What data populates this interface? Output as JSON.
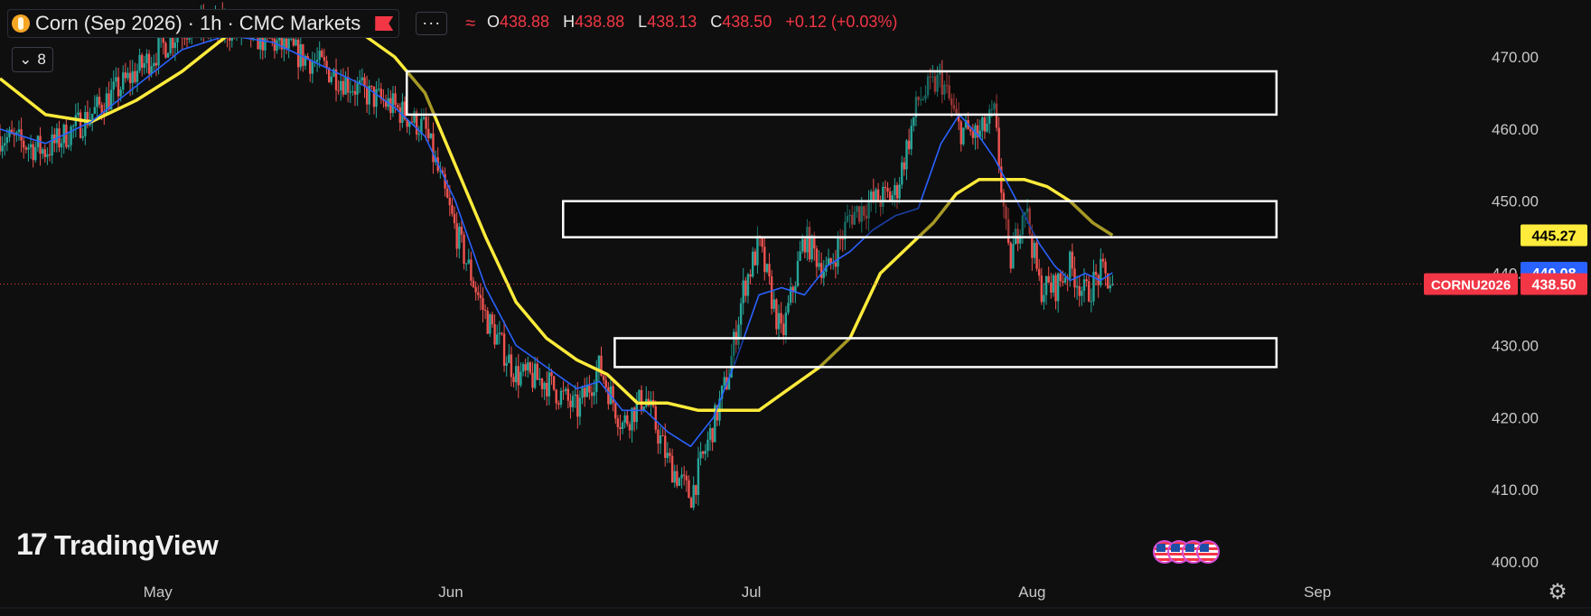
{
  "header": {
    "symbol_title": "Corn (Sep 2026)",
    "sep1": "·",
    "interval": "1h",
    "sep2": "·",
    "source": "CMC Markets",
    "more_label": "···",
    "wave_glyph": "≈",
    "ohlc": {
      "o_label": "O",
      "o_value": "438.88",
      "h_label": "H",
      "h_value": "438.88",
      "l_label": "L",
      "l_value": "438.13",
      "c_label": "C",
      "c_value": "438.50",
      "change": "+0.12 (+0.03%)"
    },
    "indicator_count": "8",
    "collapse_icon": "chevron-down-icon"
  },
  "branding": {
    "logo_mark": "17",
    "logo_text": "TradingView"
  },
  "icons": {
    "symbol": "corn-coin-icon",
    "events": "us-flag-icon",
    "settings": "gear-icon"
  },
  "colors": {
    "background": "#0f0f0f",
    "candle_up": "#26a69a",
    "candle_down": "#ef5350",
    "ma_long": "#ffeb3b",
    "ma_short": "#2962ff",
    "box_stroke": "#ffffff",
    "label_red": "#f23645",
    "label_blue": "#2962ff",
    "label_yellow": "#ffeb3b"
  },
  "price_labels": [
    {
      "value": "445.27",
      "color": "#ffeb3b",
      "text_color": "#000000"
    },
    {
      "value": "440.08",
      "color": "#2962ff",
      "text_color": "#ffffff"
    },
    {
      "value": "438.50",
      "color": "#f23645",
      "text_color": "#ffffff",
      "tag": "CORNU2026"
    }
  ],
  "chart_data": {
    "type": "line",
    "grid": false,
    "y_axis": {
      "side": "right",
      "ylim": [
        400,
        470
      ],
      "ticks": [
        "470.00",
        "460.00",
        "450.00",
        "440.00",
        "430.00",
        "420.00",
        "410.00",
        "400.00"
      ]
    },
    "x_axis": {
      "ticks": [
        "May",
        "Jun",
        "Jul",
        "Aug",
        "Sep"
      ]
    },
    "x_ticks_index": [
      0.104,
      0.297,
      0.495,
      0.68,
      0.868
    ],
    "last_price": 438.5,
    "series": [
      {
        "role": "price",
        "x": [
          0.0,
          0.03,
          0.06,
          0.09,
          0.12,
          0.15,
          0.18,
          0.21,
          0.24,
          0.26,
          0.28,
          0.3,
          0.32,
          0.34,
          0.36,
          0.38,
          0.395,
          0.41,
          0.425,
          0.44,
          0.455,
          0.47,
          0.48,
          0.49,
          0.5,
          0.515,
          0.53,
          0.545,
          0.56,
          0.575,
          0.59,
          0.605,
          0.62,
          0.632,
          0.645,
          0.655,
          0.665,
          0.675,
          0.685,
          0.695,
          0.705,
          0.715,
          0.725,
          0.733
        ],
        "y": [
          459,
          457,
          462,
          468,
          474,
          474,
          472,
          469,
          465,
          463,
          460,
          446,
          434,
          426,
          425,
          421,
          427,
          419,
          423,
          414,
          409,
          419,
          426,
          438,
          444,
          431,
          445,
          440,
          448,
          450,
          451,
          464,
          467,
          460,
          459,
          462,
          441,
          450,
          438,
          438,
          441,
          437,
          440,
          438.5
        ]
      },
      {
        "role": "moving-average-long",
        "x": [
          0.0,
          0.03,
          0.06,
          0.09,
          0.12,
          0.15,
          0.18,
          0.21,
          0.24,
          0.26,
          0.28,
          0.3,
          0.32,
          0.34,
          0.36,
          0.38,
          0.4,
          0.42,
          0.44,
          0.46,
          0.48,
          0.5,
          0.52,
          0.54,
          0.56,
          0.58,
          0.6,
          0.615,
          0.63,
          0.645,
          0.66,
          0.675,
          0.69,
          0.705,
          0.72,
          0.733
        ],
        "y": [
          467,
          462,
          461,
          464,
          468,
          473,
          475,
          474,
          473,
          470,
          465,
          455,
          445,
          436,
          431,
          428,
          426,
          422,
          422,
          421,
          421,
          421,
          424,
          427,
          431,
          440,
          444,
          447,
          451,
          453,
          453,
          453,
          452,
          450,
          447,
          445.27
        ]
      },
      {
        "role": "moving-average-short",
        "x": [
          0.0,
          0.03,
          0.06,
          0.09,
          0.12,
          0.15,
          0.18,
          0.21,
          0.24,
          0.26,
          0.28,
          0.3,
          0.32,
          0.34,
          0.36,
          0.38,
          0.395,
          0.41,
          0.425,
          0.44,
          0.455,
          0.47,
          0.485,
          0.5,
          0.515,
          0.53,
          0.545,
          0.56,
          0.575,
          0.59,
          0.605,
          0.62,
          0.632,
          0.645,
          0.655,
          0.665,
          0.675,
          0.685,
          0.695,
          0.705,
          0.715,
          0.725,
          0.733
        ],
        "y": [
          460,
          458,
          461,
          466,
          471,
          473,
          472,
          469,
          466,
          463,
          459,
          450,
          438,
          430,
          427,
          424,
          425,
          421,
          421,
          418,
          416,
          420,
          428,
          437,
          438,
          437,
          441,
          443,
          446,
          448,
          449,
          458,
          462,
          459,
          456,
          452,
          448,
          444,
          441,
          439,
          440,
          439,
          440.08
        ]
      }
    ],
    "zones": [
      {
        "label": "",
        "y_top": 468.0,
        "y_bottom": 462.0,
        "x_start": 0.268,
        "x_end": 0.841
      },
      {
        "label": "",
        "y_top": 450.0,
        "y_bottom": 445.0,
        "x_start": 0.371,
        "x_end": 0.841
      },
      {
        "label": "",
        "y_top": 431.0,
        "y_bottom": 427.0,
        "x_start": 0.405,
        "x_end": 0.841
      }
    ]
  }
}
